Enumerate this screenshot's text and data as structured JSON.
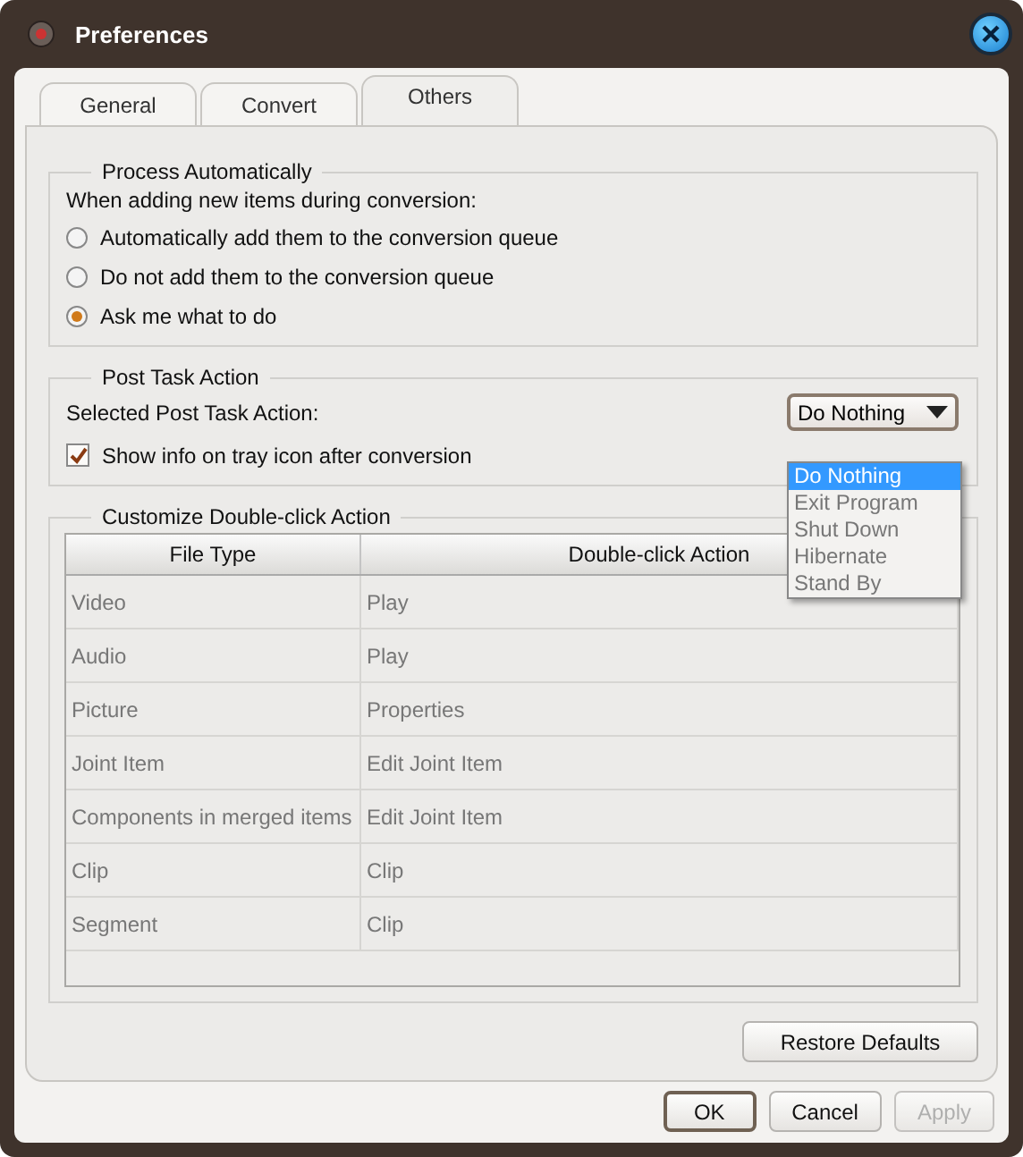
{
  "window": {
    "title": "Preferences"
  },
  "tabs": [
    {
      "label": "General",
      "selected": false
    },
    {
      "label": "Convert",
      "selected": false
    },
    {
      "label": "Others",
      "selected": true
    }
  ],
  "process_automatically": {
    "title": "Process Automatically",
    "prompt": "When adding new items during conversion:",
    "options": [
      {
        "label": "Automatically add them to the conversion queue",
        "selected": false
      },
      {
        "label": "Do not add them to the conversion queue",
        "selected": false
      },
      {
        "label": "Ask me what to do",
        "selected": true
      }
    ]
  },
  "post_task_action": {
    "title": "Post Task Action",
    "label": "Selected Post Task Action:",
    "value": "Do Nothing",
    "expanded": true,
    "options": [
      {
        "label": "Do Nothing",
        "selected": true
      },
      {
        "label": "Exit Program",
        "selected": false
      },
      {
        "label": "Shut Down",
        "selected": false
      },
      {
        "label": "Hibernate",
        "selected": false
      },
      {
        "label": "Stand By",
        "selected": false
      }
    ],
    "tray_info": {
      "label": "Show info on tray icon after conversion",
      "checked": true
    }
  },
  "double_click": {
    "title": "Customize Double-click Action",
    "columns": [
      "File Type",
      "Double-click Action"
    ],
    "rows": [
      [
        "Video",
        "Play"
      ],
      [
        "Audio",
        "Play"
      ],
      [
        "Picture",
        "Properties"
      ],
      [
        "Joint Item",
        "Edit Joint Item"
      ],
      [
        "Components in merged items",
        "Edit Joint Item"
      ],
      [
        "Clip",
        "Clip"
      ],
      [
        "Segment",
        "Clip"
      ]
    ]
  },
  "restore_button": "Restore Defaults",
  "buttons": [
    {
      "label": "OK",
      "disabled": false,
      "default": true
    },
    {
      "label": "Cancel",
      "disabled": false,
      "default": false
    },
    {
      "label": "Apply",
      "disabled": true,
      "default": false
    }
  ]
}
